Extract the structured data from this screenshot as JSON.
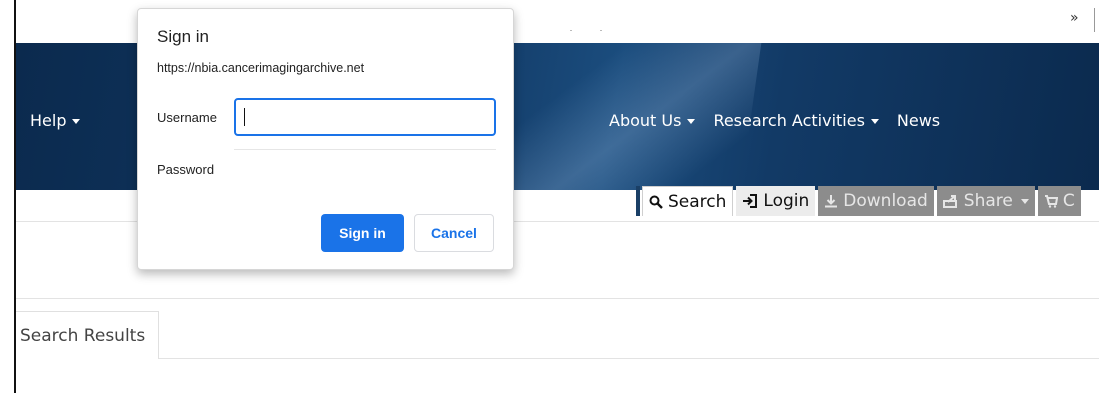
{
  "browser": {
    "overflow_label": "»"
  },
  "nav": {
    "help_label": "Help",
    "right_items": [
      {
        "label": "About Us",
        "dropdown": true
      },
      {
        "label": "Research Activities",
        "dropdown": true
      },
      {
        "label": "News",
        "dropdown": false
      }
    ]
  },
  "toolbar": {
    "search_label": "Search",
    "login_label": "Login",
    "download_label": "Download",
    "share_label": "Share",
    "cart_label": "C"
  },
  "content": {
    "results_tab_label": "Search Results"
  },
  "dialog": {
    "title": "Sign in",
    "url": "https://nbia.cancerimagingarchive.net",
    "username_label": "Username",
    "username_value": "",
    "password_label": "Password",
    "password_value": "",
    "signin_label": "Sign in",
    "cancel_label": "Cancel"
  },
  "colors": {
    "banner": "#123a66",
    "accent_blue": "#1a73e8",
    "disabled_tab": "#8c8c8c"
  }
}
